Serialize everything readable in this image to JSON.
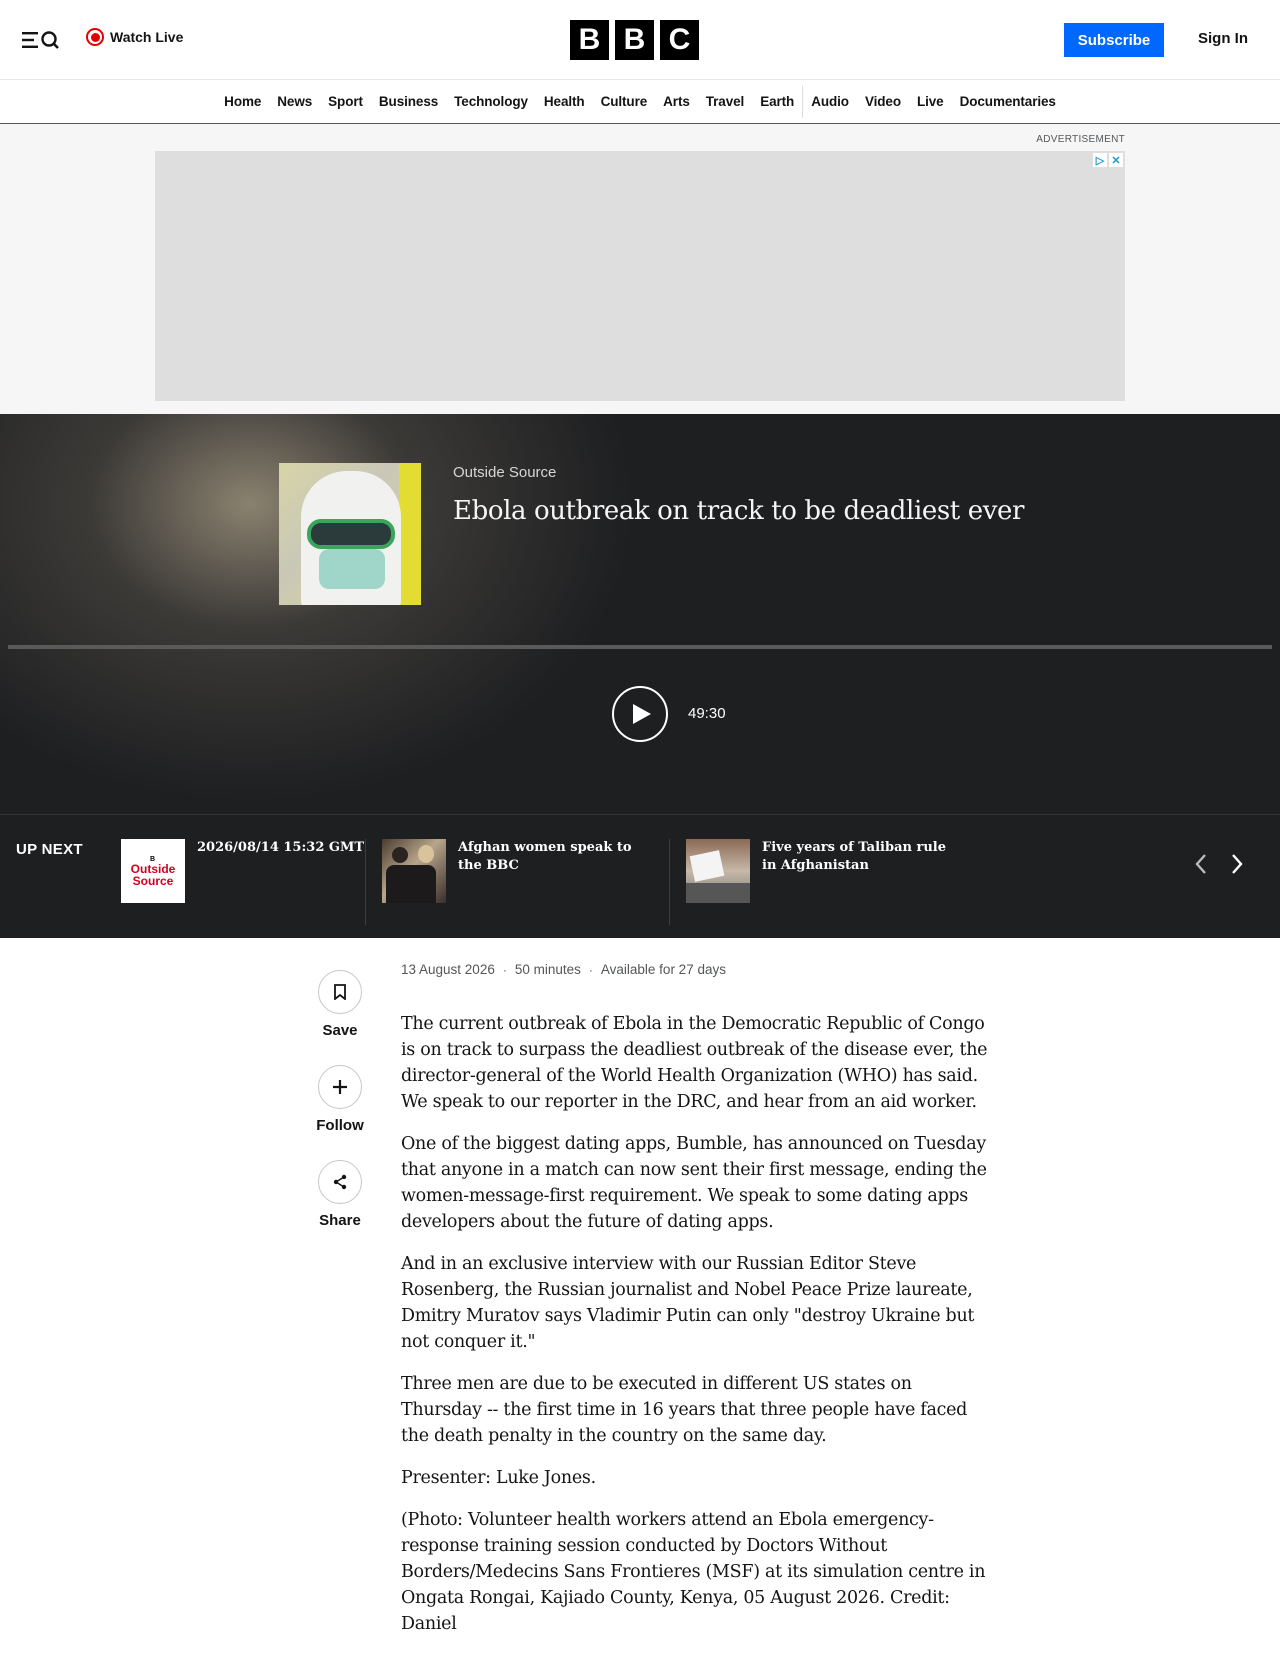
{
  "header": {
    "watch_live": "Watch Live",
    "logo_letters": [
      "B",
      "B",
      "C"
    ],
    "subscribe": "Subscribe",
    "sign_in": "Sign In"
  },
  "nav": {
    "items": [
      "Home",
      "News",
      "Sport",
      "Business",
      "Technology",
      "Health",
      "Culture",
      "Arts",
      "Travel",
      "Earth",
      "Audio",
      "Video",
      "Live",
      "Documentaries"
    ]
  },
  "advert": {
    "label": "ADVERTISEMENT"
  },
  "player": {
    "programme": "Outside Source",
    "title": "Ebola outbreak on track to be deadliest ever",
    "duration": "49:30"
  },
  "up_next": {
    "label": "UP NEXT",
    "items": [
      {
        "title": "2026/08/14 15:32 GMT",
        "thumb_text": "Outside Source"
      },
      {
        "title": "Afghan women speak to the BBC"
      },
      {
        "title": "Five years of Taliban rule in Afghanistan"
      }
    ]
  },
  "actions": {
    "save": "Save",
    "follow": "Follow",
    "share": "Share"
  },
  "meta": {
    "date": "13 August 2026",
    "length": "50 minutes",
    "availability": "Available for 27 days"
  },
  "body": {
    "paragraphs": [
      "The current outbreak of Ebola in the Democratic Republic of Congo is on track to surpass the deadliest outbreak of the disease ever, the director-general of the World Health Organization (WHO) has said. We speak to our reporter in the DRC, and hear from an aid worker.",
      "One of the biggest dating apps, Bumble, has announced on Tuesday that anyone in a match can now sent their first message, ending the women-message-first requirement. We speak to some dating apps developers about the future of dating apps.",
      "And in an exclusive interview with our Russian Editor Steve Rosenberg, the Russian journalist and Nobel Peace Prize laureate, Dmitry Muratov says Vladimir Putin can only \"destroy Ukraine but not conquer it.\"",
      "Three men are due to be executed in different US states on Thursday -- the first time in 16 years that three people have faced the death penalty in the country on the same day.",
      "Presenter: Luke Jones.",
      "(Photo: Volunteer health workers attend an Ebola emergency-response training session conducted by Doctors Without Borders/Medecins Sans Frontieres (MSF) at its simulation centre in Ongata Rongai, Kajiado County, Kenya, 05 August 2026. Credit: Daniel"
    ]
  }
}
